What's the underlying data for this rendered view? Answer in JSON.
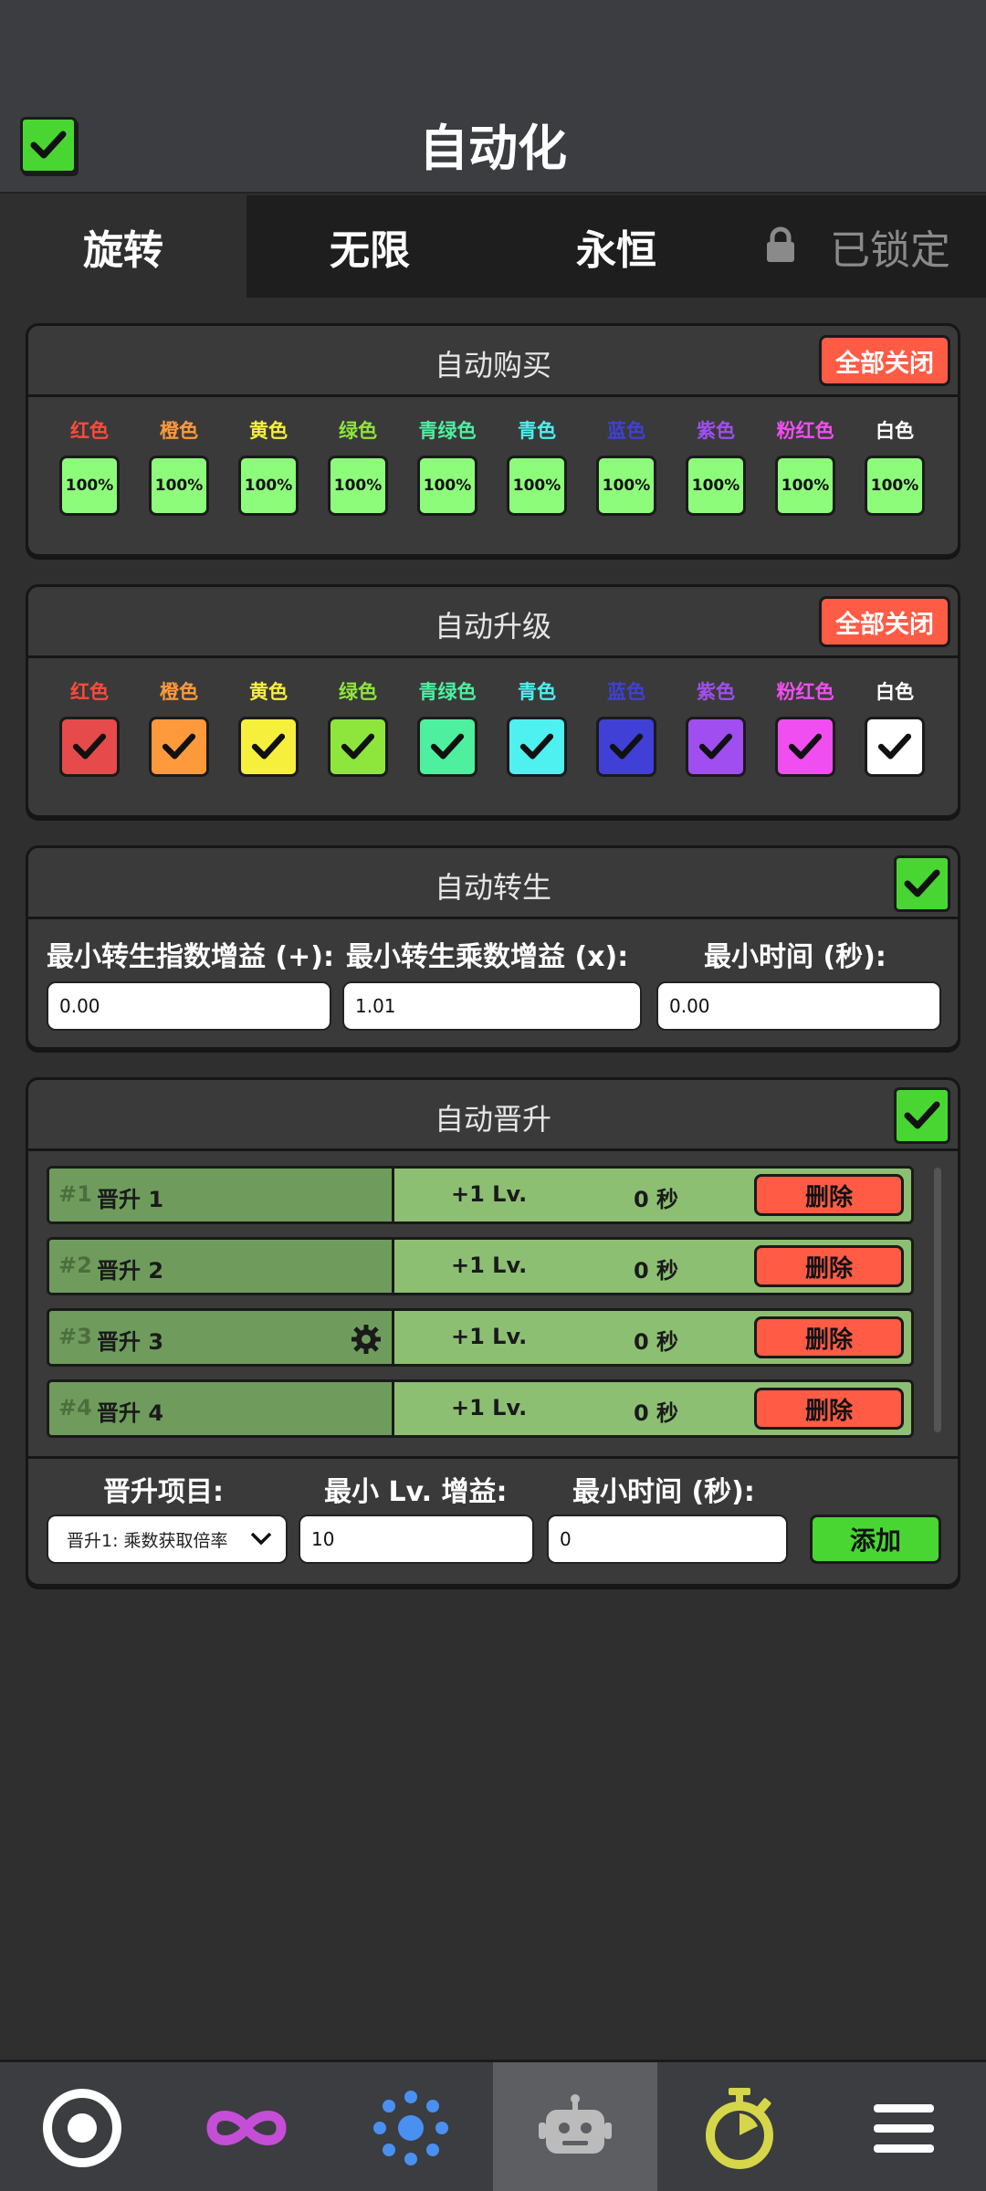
{
  "header": {
    "title": "自动化",
    "master_toggle": true
  },
  "tabs": [
    {
      "label": "旋转",
      "active": true
    },
    {
      "label": "无限",
      "active": false
    },
    {
      "label": "永恒",
      "active": false
    },
    {
      "label": "已锁定",
      "locked": true
    }
  ],
  "colors": [
    {
      "label": "红色",
      "fg": "#ff4a3c",
      "bg": "#e64a4a"
    },
    {
      "label": "橙色",
      "fg": "#ff9a3c",
      "bg": "#ff9a3c"
    },
    {
      "label": "黄色",
      "fg": "#f6f03c",
      "bg": "#f6f03c"
    },
    {
      "label": "绿色",
      "fg": "#8ee63c",
      "bg": "#8ee63c"
    },
    {
      "label": "青绿色",
      "fg": "#4ef0a0",
      "bg": "#4ef0a0"
    },
    {
      "label": "青色",
      "fg": "#4ef0f0",
      "bg": "#4ef0f0"
    },
    {
      "label": "蓝色",
      "fg": "#4040d6",
      "bg": "#4040d6"
    },
    {
      "label": "紫色",
      "fg": "#a04ef0",
      "bg": "#a04ef0"
    },
    {
      "label": "粉红色",
      "fg": "#f04ef0",
      "bg": "#f04ef0"
    },
    {
      "label": "白色",
      "fg": "#ffffff",
      "bg": "#ffffff"
    }
  ],
  "auto_buy": {
    "title": "自动购买",
    "off_label": "全部关闭",
    "value": "100%"
  },
  "auto_upgrade": {
    "title": "自动升级",
    "off_label": "全部关闭",
    "checked": true
  },
  "auto_rebirth": {
    "title": "自动转生",
    "enabled": true,
    "fields": [
      {
        "label": "最小转生指数增益 (+):",
        "value": "0.00"
      },
      {
        "label": "最小转生乘数增益 (x):",
        "value": "1.01"
      },
      {
        "label": "最小时间 (秒):",
        "value": "0.00"
      }
    ]
  },
  "auto_ascend": {
    "title": "自动晋升",
    "enabled": true,
    "rows": [
      {
        "num": "#1",
        "name": "晋升 1",
        "lv": "+1 Lv.",
        "time": "0 秒",
        "delete": "删除",
        "gear": false
      },
      {
        "num": "#2",
        "name": "晋升 2",
        "lv": "+1 Lv.",
        "time": "0 秒",
        "delete": "删除",
        "gear": false
      },
      {
        "num": "#3",
        "name": "晋升 3",
        "lv": "+1 Lv.",
        "time": "0 秒",
        "delete": "删除",
        "gear": true
      },
      {
        "num": "#4",
        "name": "晋升 4",
        "lv": "+1 Lv.",
        "time": "0 秒",
        "delete": "删除",
        "gear": false
      }
    ],
    "item_label": "晋升项目:",
    "min_lv_label": "最小 Lv. 增益:",
    "min_time_label": "最小时间 (秒):",
    "select_value": "晋升1: 乘数获取倍率",
    "min_lv_value": "10",
    "min_time_value": "0",
    "add_label": "添加"
  },
  "nav": [
    {
      "icon": "target-icon"
    },
    {
      "icon": "infinity-icon"
    },
    {
      "icon": "sparkle-icon"
    },
    {
      "icon": "robot-icon",
      "active": true
    },
    {
      "icon": "stopwatch-icon"
    },
    {
      "icon": "menu-icon"
    }
  ]
}
